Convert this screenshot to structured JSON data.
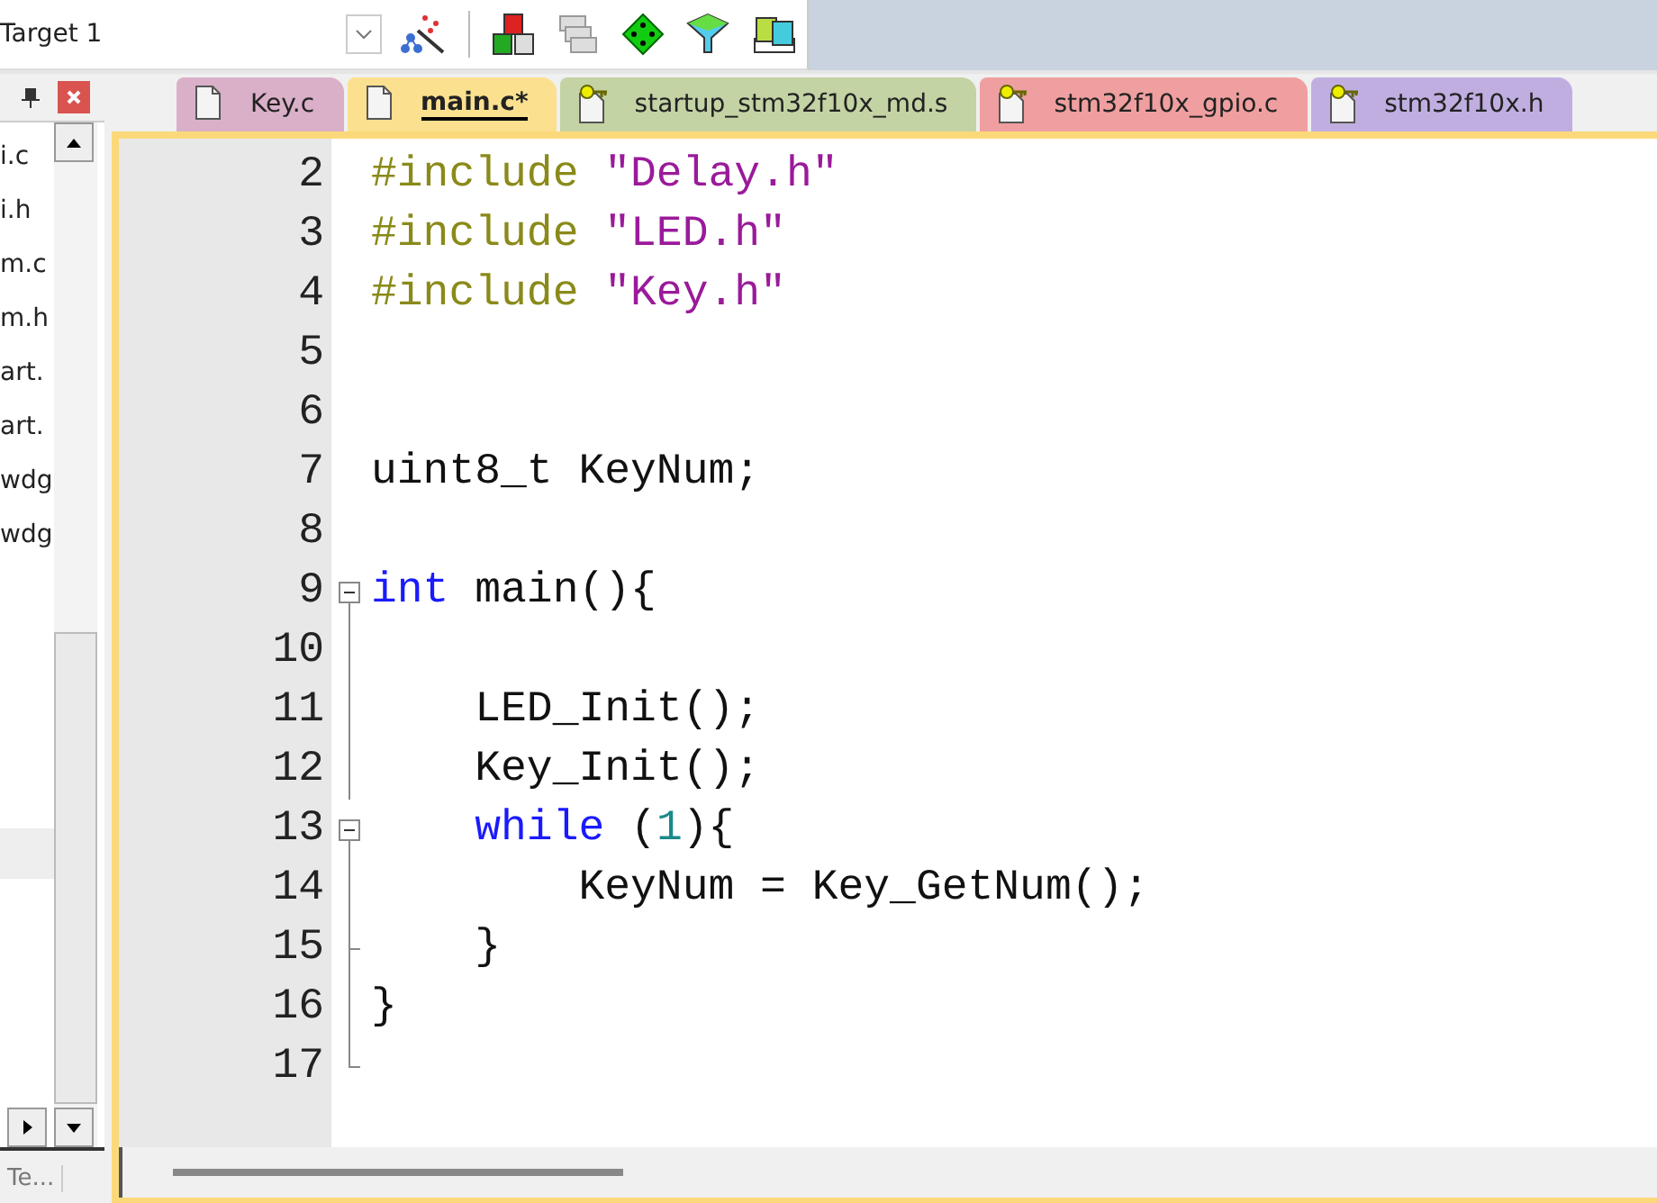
{
  "toolbar": {
    "target": "Target 1"
  },
  "project_panel": {
    "files": [
      "i.c",
      "i.h",
      "m.c",
      "m.h",
      "art.",
      "art.",
      "wdg",
      "wdg"
    ],
    "bottom_tab": "Te..."
  },
  "tabs": [
    {
      "label": "Key.c",
      "kind": "plain",
      "color": "#d9b0c8",
      "selected": false
    },
    {
      "label": "main.c*",
      "kind": "plain",
      "color": "#fbe08f",
      "selected": true
    },
    {
      "label": "startup_stm32f10x_md.s",
      "kind": "keyed",
      "color": "#c3d3a4",
      "selected": false
    },
    {
      "label": "stm32f10x_gpio.c",
      "kind": "keyed",
      "color": "#ef9f9f",
      "selected": false
    },
    {
      "label": "stm32f10x.h",
      "kind": "keyed",
      "color": "#c0aee0",
      "selected": false
    }
  ],
  "lines": [
    {
      "number": "2",
      "kind": "plain",
      "tokens": [
        {
          "kind": "preproc",
          "text": "#include "
        },
        {
          "kind": "string",
          "text": "\"Delay.h\""
        }
      ]
    },
    {
      "number": "3",
      "kind": "plain",
      "tokens": [
        {
          "kind": "preproc",
          "text": "#include "
        },
        {
          "kind": "string",
          "text": "\"LED.h\""
        }
      ]
    },
    {
      "number": "4",
      "kind": "plain",
      "tokens": [
        {
          "kind": "preproc",
          "text": "#include "
        },
        {
          "kind": "string",
          "text": "\"Key.h\""
        }
      ]
    },
    {
      "number": "5",
      "kind": "plain"
    },
    {
      "number": "6",
      "kind": "plain"
    },
    {
      "number": "7",
      "kind": "plain",
      "tokens": [
        {
          "kind": "plain",
          "text": "uint8_t KeyNum;"
        }
      ]
    },
    {
      "number": "8",
      "kind": "plain"
    },
    {
      "number": "9",
      "kind": "fold-start",
      "tokens": [
        {
          "kind": "keyword",
          "text": "int"
        },
        {
          "kind": "plain",
          "text": " main(){"
        }
      ]
    },
    {
      "number": "10",
      "kind": "fold-body"
    },
    {
      "number": "11",
      "kind": "fold-body",
      "tokens": [
        {
          "kind": "plain",
          "text": "    LED_Init();"
        }
      ]
    },
    {
      "number": "12",
      "kind": "fold-body",
      "tokens": [
        {
          "kind": "plain",
          "text": "    Key_Init();"
        }
      ]
    },
    {
      "number": "13",
      "kind": "fold-start",
      "tokens": [
        {
          "kind": "keyword",
          "text": "    while"
        },
        {
          "kind": "plain",
          "text": " ("
        },
        {
          "kind": "number",
          "text": "1"
        },
        {
          "kind": "plain",
          "text": "){"
        }
      ]
    },
    {
      "number": "14",
      "kind": "fold-body",
      "tokens": [
        {
          "kind": "plain",
          "text": "        KeyNum = Key_GetNum();"
        }
      ]
    },
    {
      "number": "15",
      "kind": "fold-inner-end",
      "tokens": [
        {
          "kind": "plain",
          "text": "    }"
        }
      ]
    },
    {
      "number": "16",
      "kind": "fold-body",
      "tokens": [
        {
          "kind": "plain",
          "text": "}"
        }
      ]
    },
    {
      "number": "17",
      "kind": "fold-end"
    }
  ]
}
